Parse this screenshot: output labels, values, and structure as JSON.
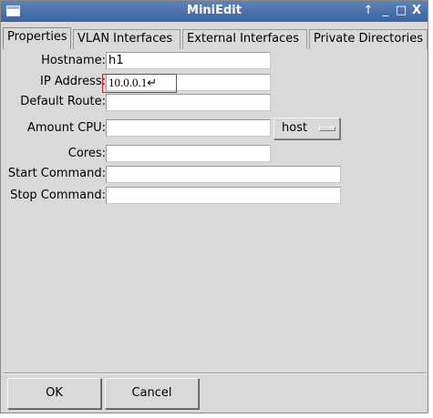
{
  "window": {
    "title": "MiniEdit",
    "controls": {
      "up": "↑",
      "minimize": "_",
      "maximize": "□",
      "close": "X"
    }
  },
  "tabs": [
    {
      "label": "Properties",
      "selected": true
    },
    {
      "label": "VLAN Interfaces",
      "selected": false
    },
    {
      "label": "External Interfaces",
      "selected": false
    },
    {
      "label": "Private Directories",
      "selected": false
    }
  ],
  "form": {
    "hostname": {
      "label": "Hostname:",
      "value": "h1"
    },
    "ip_address": {
      "label": "IP Address:",
      "value": "10.0.0.1↵"
    },
    "default_route": {
      "label": "Default Route:",
      "value": ""
    },
    "amount_cpu": {
      "label": "Amount CPU:",
      "value": "",
      "option": "host"
    },
    "cores": {
      "label": "Cores:",
      "value": ""
    },
    "start_command": {
      "label": "Start Command:",
      "value": ""
    },
    "stop_command": {
      "label": "Stop Command:",
      "value": ""
    }
  },
  "buttons": {
    "ok": "OK",
    "cancel": "Cancel"
  },
  "colors": {
    "titlebar": "#3c62a0",
    "highlight": "#e02020",
    "background": "#d9d9d9"
  }
}
